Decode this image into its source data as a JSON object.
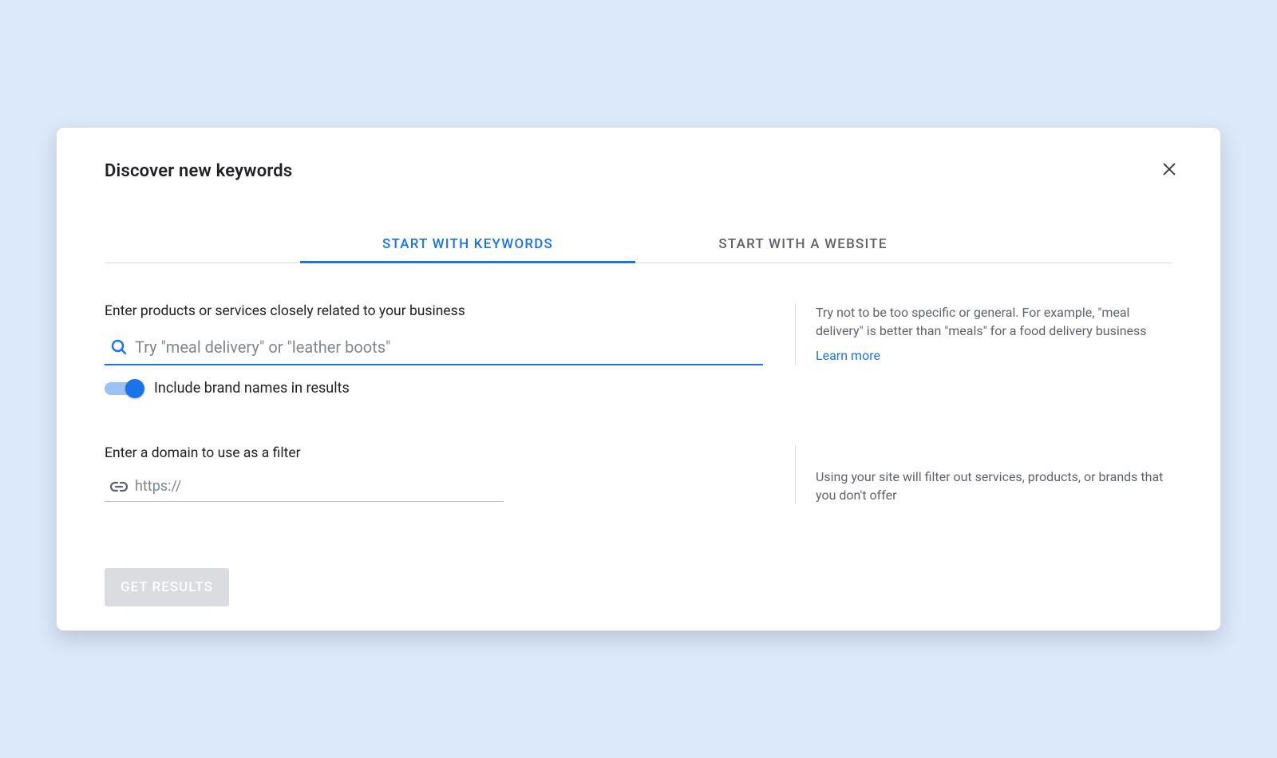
{
  "header": {
    "title": "Discover new keywords"
  },
  "tabs": {
    "keywords": "START WITH KEYWORDS",
    "website": "START WITH A WEBSITE"
  },
  "products": {
    "label": "Enter products or services closely related to your business",
    "placeholder": "Try \"meal delivery\" or \"leather boots\"",
    "tip": "Try not to be too specific or general. For example, \"meal delivery\" is better than \"meals\" for a food delivery business",
    "learn_more": "Learn more"
  },
  "toggle": {
    "label": "Include brand names in results",
    "on": true
  },
  "domain_filter": {
    "label": "Enter a domain to use as a filter",
    "placeholder": "https://",
    "tip": "Using your site will filter out services, products, or brands that you don't offer"
  },
  "actions": {
    "get_results": "GET RESULTS"
  }
}
